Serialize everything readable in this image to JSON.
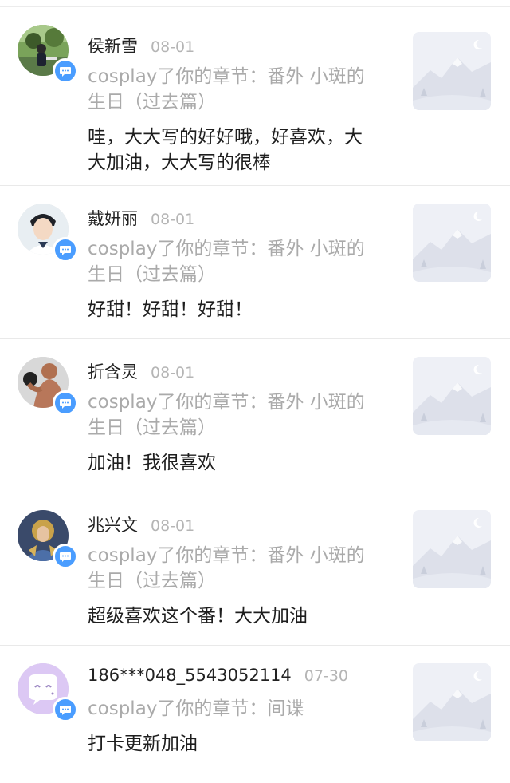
{
  "notifications": [
    {
      "user": "侯新雪",
      "date": "08-01",
      "ref_line1": "cosplay了你的章节：番外 小斑的",
      "ref_line2": "生日（过去篇）",
      "comment_line1": "哇，大大写的好好哦，好喜欢，大",
      "comment_line2": "大加油，大大写的很棒",
      "avatar_icon": "avatar-outdoor-person",
      "badge_icon": "comment-bubble-icon",
      "thumb_icon": "mountain-placeholder-icon"
    },
    {
      "user": "戴妍丽",
      "date": "08-01",
      "ref_line1": "cosplay了你的章节：番外 小斑的",
      "ref_line2": "生日（过去篇）",
      "comment_line1": "好甜！好甜！好甜！",
      "comment_line2": "",
      "avatar_icon": "avatar-young-man",
      "badge_icon": "comment-bubble-icon",
      "thumb_icon": "mountain-placeholder-icon"
    },
    {
      "user": "折含灵",
      "date": "08-01",
      "ref_line1": "cosplay了你的章节：番外 小斑的",
      "ref_line2": "生日（过去篇）",
      "comment_line1": "加油！我很喜欢",
      "comment_line2": "",
      "avatar_icon": "avatar-bodybuilder",
      "badge_icon": "comment-bubble-icon",
      "thumb_icon": "mountain-placeholder-icon"
    },
    {
      "user": "兆兴文",
      "date": "08-01",
      "ref_line1": "cosplay了你的章节：番外 小斑的",
      "ref_line2": "生日（过去篇）",
      "comment_line1": "超级喜欢这个番！大大加油",
      "comment_line2": "",
      "avatar_icon": "avatar-game-hero",
      "badge_icon": "comment-bubble-icon",
      "thumb_icon": "mountain-placeholder-icon"
    },
    {
      "user": "186***048_5543052114",
      "date": "07-30",
      "ref_line1": "cosplay了你的章节：间谍",
      "ref_line2": "",
      "comment_line1": "打卡更新加油",
      "comment_line2": "",
      "avatar_icon": "avatar-default-cartoon",
      "badge_icon": "comment-bubble-icon",
      "thumb_icon": "mountain-placeholder-icon"
    }
  ],
  "colors": {
    "badge": "#4a9dff",
    "date": "#b5b5b5",
    "ref_text": "#aaaaaa",
    "comment_text": "#1e1e1e",
    "divider": "#e9e9e9",
    "thumb_bg": "#eef0f6"
  }
}
